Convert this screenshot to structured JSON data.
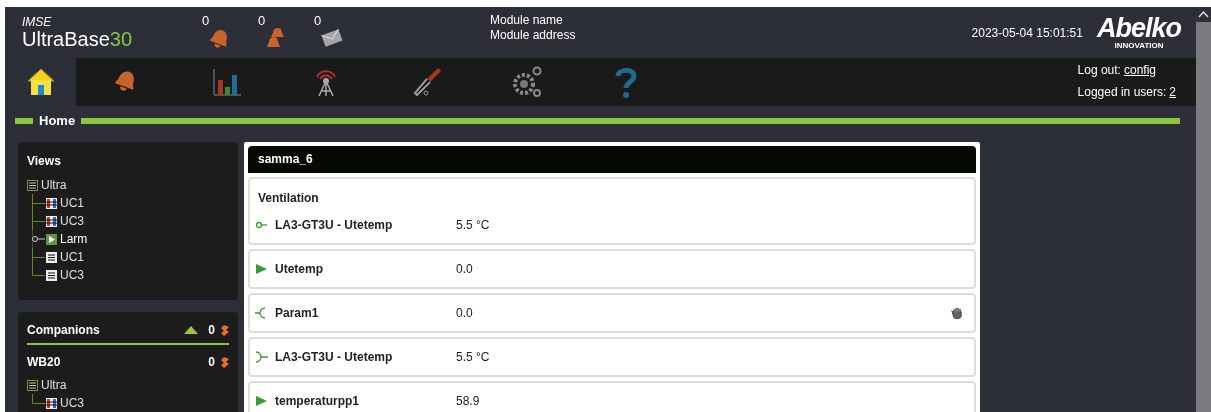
{
  "brand": {
    "vendor": "IMSE",
    "product": "UltraBase",
    "version": "30"
  },
  "counters": [
    {
      "kind": "alarm",
      "value": "0"
    },
    {
      "kind": "multi-alarm",
      "value": "0"
    },
    {
      "kind": "message",
      "value": "0"
    }
  ],
  "module": {
    "name": "Module name",
    "address": "Module address"
  },
  "datetime": "2023-05-04 15:01:51",
  "logo": {
    "name": "Abelko",
    "tagline": "INNOVATION"
  },
  "nav": [
    {
      "kind": "home",
      "selected": true
    },
    {
      "kind": "alarm",
      "selected": false
    },
    {
      "kind": "chart",
      "selected": false
    },
    {
      "kind": "antenna",
      "selected": false
    },
    {
      "kind": "tools",
      "selected": false
    },
    {
      "kind": "settings",
      "selected": false
    },
    {
      "kind": "help",
      "selected": false
    }
  ],
  "login": {
    "logout_label": "Log out:",
    "user": "config",
    "users_label": "Logged in users:",
    "users_count": "2"
  },
  "page_title": "Home",
  "views": {
    "title": "Views",
    "tree": [
      {
        "label": "Ultra",
        "kind": "folder",
        "selected": false,
        "children": [
          {
            "label": "UC1",
            "kind": "unit",
            "selected": false
          },
          {
            "label": "UC3",
            "kind": "unit",
            "selected": false
          },
          {
            "label": "Larm",
            "kind": "alarm-view",
            "selected": true
          },
          {
            "label": "UC1",
            "kind": "list",
            "selected": false
          },
          {
            "label": "UC3",
            "kind": "list",
            "selected": false
          }
        ]
      }
    ]
  },
  "companions": {
    "title": "Companions",
    "count": "0",
    "devices": [
      {
        "name": "WB20",
        "count": "0",
        "tree": [
          {
            "label": "Ultra",
            "kind": "folder",
            "selected": false,
            "children": [
              {
                "label": "UC3",
                "kind": "unit",
                "selected": false
              }
            ]
          }
        ]
      }
    ]
  },
  "panel": {
    "title": "samma_6",
    "section": "Ventilation",
    "rows": [
      {
        "kind": "input",
        "name": "LA3-GT3U - Utetemp",
        "value": "5.5 °C",
        "manual": false
      },
      {
        "kind": "variable",
        "name": "Utetemp",
        "value": "0.0",
        "manual": false
      },
      {
        "kind": "parameter",
        "name": "Param1",
        "value": "0.0",
        "manual": true
      },
      {
        "kind": "output",
        "name": "LA3-GT3U - Utetemp",
        "value": "5.5 °C",
        "manual": false
      },
      {
        "kind": "variable",
        "name": "temperaturpp1",
        "value": "58.9",
        "manual": false
      }
    ]
  }
}
